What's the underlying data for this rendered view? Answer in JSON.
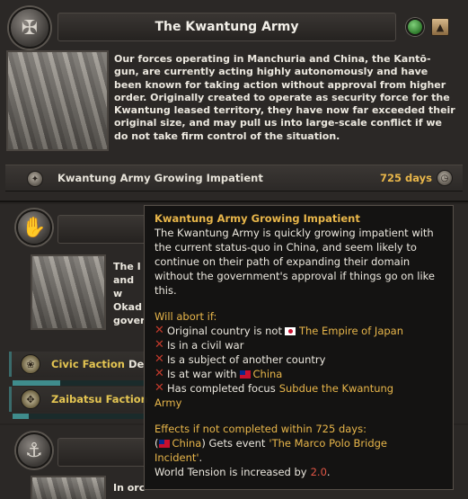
{
  "decision": {
    "title": "The Kwantung Army",
    "emblem_icon": "army-emblem-icon",
    "description": "Our forces operating in Manchuria and China, the Kantō-gun, are currently acting highly autonomously and have been known for taking action without approval from higher order. Originally created to operate as security force for the Kwantung leased territory, they have now far exceeded their original size, and may pull us into large-scale conflict if we do not take firm control of the situation."
  },
  "mission": {
    "label": "Kwantung Army Growing Impatient",
    "days": "725 days"
  },
  "second_decision": {
    "desc_fragments": [
      "The I",
      "and w",
      "Okad",
      "gover"
    ],
    "factions": [
      {
        "name": "Civic Faction",
        "tail": "De",
        "progress": 0.35
      },
      {
        "name": "Zaibatsu Faction",
        "tail": "",
        "progress": 0.12
      }
    ]
  },
  "third_decision": {
    "desc_fragment": "In orc"
  },
  "tooltip": {
    "title": "Kwantung Army Growing Impatient",
    "body": "The Kwantung Army is quickly growing impatient with the current status-quo in China, and seem likely to continue on their path of expanding their domain without the government's approval if things go on like this.",
    "abort_header": "Will abort if:",
    "abort_1_prefix": "Original country is not",
    "abort_1_country": "The Empire of Japan",
    "abort_2": "Is in a civil war",
    "abort_3": "Is a subject of another country",
    "abort_4_prefix": "Is at war with",
    "abort_4_country": "China",
    "abort_5_prefix": "Has completed focus",
    "abort_5_focus_a": "Subdue the Kwantung",
    "abort_5_focus_b": "Army",
    "effects_header": "Effects if not completed within 725 days:",
    "effect_1_open": "(",
    "effect_1_country": "China",
    "effect_1_mid": ") Gets event",
    "effect_1_event_a": "'The Marco Polo Bridge",
    "effect_1_event_b": "Incident'",
    "effect_1_end": ".",
    "effect_2_prefix": "World Tension is increased by",
    "effect_2_value": "2.0",
    "effect_2_end": "."
  },
  "colors": {
    "gold": "#e8b64a",
    "red": "#e05545",
    "panel": "#2b2826"
  }
}
